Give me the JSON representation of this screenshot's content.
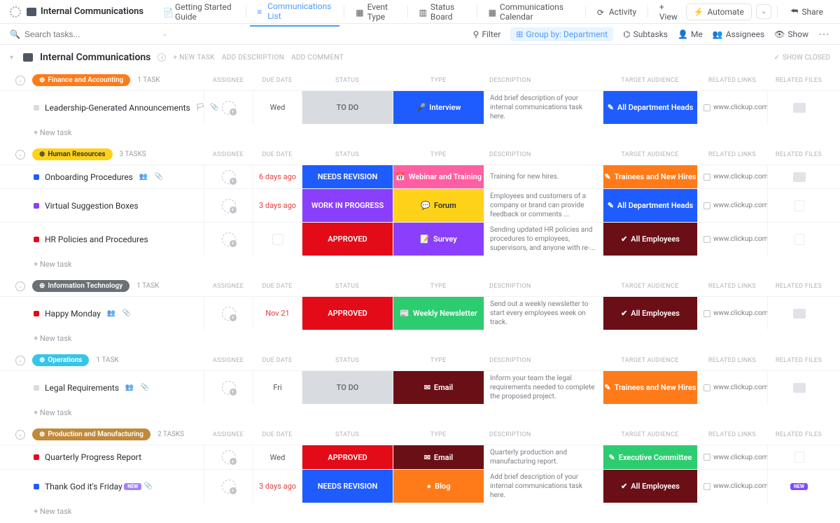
{
  "header": {
    "title": "Internal Communications",
    "views": [
      {
        "label": "Getting Started Guide"
      },
      {
        "label": "Communications List",
        "active": true
      },
      {
        "label": "Event Type"
      },
      {
        "label": "Status Board"
      },
      {
        "label": "Communications Calendar"
      },
      {
        "label": "Activity"
      }
    ],
    "add_view": "+  View",
    "automate": "Automate",
    "share": "Share"
  },
  "filterbar": {
    "search_placeholder": "Search tasks...",
    "filter": "Filter",
    "group_by": "Group by: Department",
    "subtasks": "Subtasks",
    "me": "Me",
    "assignees": "Assignees",
    "show": "Show"
  },
  "list_header": {
    "title": "Internal Communications",
    "new_task": "+ NEW TASK",
    "add_desc": "ADD DESCRIPTION",
    "add_comment": "ADD COMMENT",
    "show_closed": "SHOW CLOSED"
  },
  "columns": {
    "assignee": "ASSIGNEE",
    "due_date": "DUE DATE",
    "status": "STATUS",
    "type": "TYPE",
    "description": "DESCRIPTION",
    "target": "TARGET AUDIENCE",
    "links": "RELATED LINKS",
    "files": "RELATED FILES"
  },
  "new_task_label": "+ New task",
  "groups": [
    {
      "name": "Finance and Accounting",
      "pill_color": "#ff7b1a",
      "count": "1 TASK",
      "tasks": [
        {
          "sq": "#d8dbdf",
          "name": "Leadership-Generated Announcements",
          "name_icons": [
            "flag",
            "clip"
          ],
          "due": "Wed",
          "overdue": false,
          "status": {
            "label": "TO DO",
            "bg": "#d8dbdf",
            "color": "#6b6f76"
          },
          "type": {
            "label": "Interview",
            "bg": "#1f5cff",
            "icon": "🎤"
          },
          "desc": "Add brief description of your internal communications task here.",
          "target": {
            "label": "All Department Heads",
            "bg": "#1f5cff",
            "icon": "✎"
          },
          "link": "www.clickup.com",
          "file": "thumb"
        }
      ]
    },
    {
      "name": "Human Resources",
      "pill_color": "#ffd21a",
      "textcolor": "#2a2e34",
      "count": "3 TASKS",
      "tasks": [
        {
          "sq": "#1f5cff",
          "name": "Onboarding Procedures",
          "name_icons": [
            "people",
            "clip"
          ],
          "due": "6 days ago",
          "overdue": true,
          "status": {
            "label": "NEEDS REVISION",
            "bg": "#1f5cff"
          },
          "type": {
            "label": "Webinar and Training",
            "bg": "#ff5fa2",
            "icon": "📅"
          },
          "desc": "Training for new hires.",
          "target": {
            "label": "Trainees and New Hires",
            "bg": "#ff7b1a",
            "icon": "✎"
          },
          "link": "www.clickup.com",
          "file": "thumb"
        },
        {
          "sq": "#8a3ffc",
          "name": "Virtual Suggestion Boxes",
          "name_icons": [],
          "due": "3 days ago",
          "overdue": true,
          "status": {
            "label": "WORK IN PROGRESS",
            "bg": "#8a3ffc"
          },
          "type": {
            "label": "Forum",
            "bg": "#ffd21a",
            "icon": "💬",
            "textcolor": "#2a2e34"
          },
          "desc": "Employees and customers of a company or brand can provide feedback or comments ...",
          "target": {
            "label": "All Department Heads",
            "bg": "#1f5cff",
            "icon": "✎"
          },
          "link": "www.clickup.com",
          "file": "ph"
        },
        {
          "sq": "#e30b17",
          "name": "HR Policies and Procedures",
          "name_icons": [],
          "due": "",
          "overdue": false,
          "date_ph": true,
          "status": {
            "label": "APPROVED",
            "bg": "#e30b17"
          },
          "type": {
            "label": "Survey",
            "bg": "#8a3ffc",
            "icon": "📝"
          },
          "desc": "Sending updated HR policies and procedures to employees, supervisors, and anyone with re-...",
          "target": {
            "label": "All Employees",
            "bg": "#6b0f17",
            "icon": "✔"
          },
          "link": "www.clickup.com",
          "file": "ph"
        }
      ]
    },
    {
      "name": "Information Technology",
      "pill_color": "#6b6f76",
      "count": "1 TASK",
      "tasks": [
        {
          "sq": "#e30b17",
          "name": "Happy Monday",
          "name_icons": [
            "people",
            "clip"
          ],
          "due": "Nov 21",
          "overdue": true,
          "status": {
            "label": "APPROVED",
            "bg": "#e30b17"
          },
          "type": {
            "label": "Weekly Newsletter",
            "bg": "#2ecc71",
            "icon": "📰"
          },
          "desc": "Send out a weekly newsletter to start every employees week on track.",
          "target": {
            "label": "All Employees",
            "bg": "#6b0f17",
            "icon": "✔"
          },
          "link": "www.clickup.com",
          "file": "thumb"
        }
      ]
    },
    {
      "name": "Operations",
      "pill_color": "#34c6e8",
      "count": "1 TASK",
      "tasks": [
        {
          "sq": "#d8dbdf",
          "name": "Legal Requirements",
          "name_icons": [
            "people",
            "clip"
          ],
          "due": "Fri",
          "overdue": false,
          "status": {
            "label": "TO DO",
            "bg": "#d8dbdf",
            "color": "#6b6f76"
          },
          "type": {
            "label": "Email",
            "bg": "#6b0f17",
            "icon": "✉"
          },
          "desc": "Inform your team the legal requirements needed to complete the proposed project.",
          "target": {
            "label": "Trainees and New Hires",
            "bg": "#ff7b1a",
            "icon": "✎"
          },
          "link": "www.clickup.com",
          "file": "thumb"
        }
      ]
    },
    {
      "name": "Production and Manufacturing",
      "pill_color": "#c08a3a",
      "count": "2 TASKS",
      "tasks": [
        {
          "sq": "#e30b17",
          "name": "Quarterly Progress Report",
          "name_icons": [],
          "due": "Wed",
          "overdue": false,
          "status": {
            "label": "APPROVED",
            "bg": "#e30b17"
          },
          "type": {
            "label": "Email",
            "bg": "#6b0f17",
            "icon": "✉"
          },
          "desc": "Quarterly production and manufacturing report.",
          "target": {
            "label": "Executive Committee",
            "bg": "#2ecc71",
            "icon": "✎"
          },
          "link": "www.clickup.com",
          "file": "ph"
        },
        {
          "sq": "#1f5cff",
          "name": "Thank God it's Friday",
          "name_icons": [
            "label",
            "clip"
          ],
          "due": "3 days ago",
          "overdue": true,
          "status": {
            "label": "NEEDS REVISION",
            "bg": "#1f5cff"
          },
          "type": {
            "label": "Blog",
            "bg": "#ff7b1a",
            "icon": "●"
          },
          "desc": "Add brief description of your internal communications task here.",
          "target": {
            "label": "All Employees",
            "bg": "#6b0f17",
            "icon": "✔"
          },
          "link": "www.clickup.com",
          "file": "label"
        }
      ]
    }
  ]
}
